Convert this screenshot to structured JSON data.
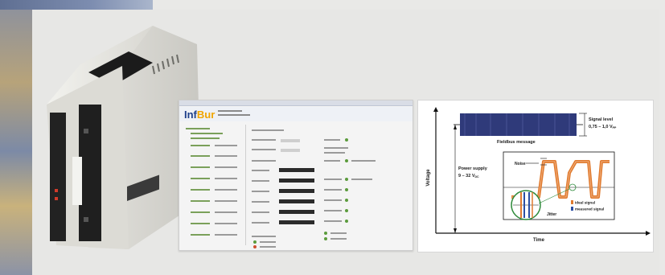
{
  "diagram": {
    "signal_level_label": "Signal level",
    "signal_level_value": "0,75 – 1,0 V",
    "signal_level_unit": "PP",
    "fieldbus_label": "Fieldbus message",
    "power_supply_label": "Power supply",
    "power_supply_value": "9 – 32 V",
    "power_supply_unit": "DC",
    "noise_label": "Noise",
    "jitter_label": "Jitter",
    "ideal_signal_label": "ideal signal",
    "measured_signal_label": "measured signal",
    "y_axis_label": "Voltage",
    "x_axis_label": "Time",
    "colors": {
      "fieldbus": "#2f3a7a",
      "ideal": "#e07a2e",
      "measured": "#2b4fa3",
      "zoom_circle": "#2e8a3a",
      "axis": "#111111"
    }
  },
  "software": {
    "logo_main": "Inf",
    "logo_accent": "Bur"
  }
}
